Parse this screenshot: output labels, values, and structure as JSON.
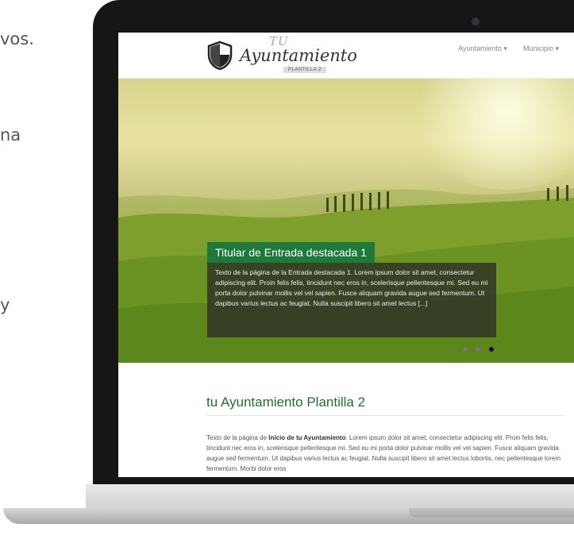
{
  "page_fragments": [
    "vos.",
    "na",
    "y"
  ],
  "site": {
    "logo": {
      "tu": "TU",
      "name": "Ayuntamiento",
      "sub": "PLANTILLA 2"
    },
    "nav": [
      {
        "label": "Ayuntamiento"
      },
      {
        "label": "Municipio"
      }
    ],
    "hero": {
      "title": "Titular de Entrada destacada 1",
      "text": "Texto de la página de la Entrada destacada 1. Lorem ipsum dolor sit amet, consectetur adipiscing elit. Proin felis felis, tincidunt nec eros in, scelerisque pellentesque mi. Sed eu mi porta dolor pulvinar mollis vel vel sapien. Fusce aliquam gravida augue sed fermentum. Ut dapibus varius lectus ac feugiat. Nulla suscipit libero sit amet lectus [...]",
      "slides": 3,
      "active_slide": 3
    },
    "main": {
      "title": "tu Ayuntamiento Plantilla 2",
      "text_prefix": "Texto de la página de ",
      "text_bold": "Inicio de tu Ayuntamiento",
      "text_rest": ". Lorem ipsum dolor sit amet, consectetur adipiscing elit. Proin felis felis, tincidunt nec eros in, scelerisque pellentesque mi. Sed eu mi porta dolor pulvinar mollis vel vel sapien. Fusce aliquam gravida augue sed fermentum. Ut dapibus varius lectus ac feugiat. Nulla suscipit libero sit amet lectus lobortis, nec pellentesque lorem fermentum. Morbi dolor eros"
    }
  },
  "colors": {
    "accent_green": "#1e7a3a",
    "title_green": "#1f6e2f",
    "bezel": "#161616"
  }
}
